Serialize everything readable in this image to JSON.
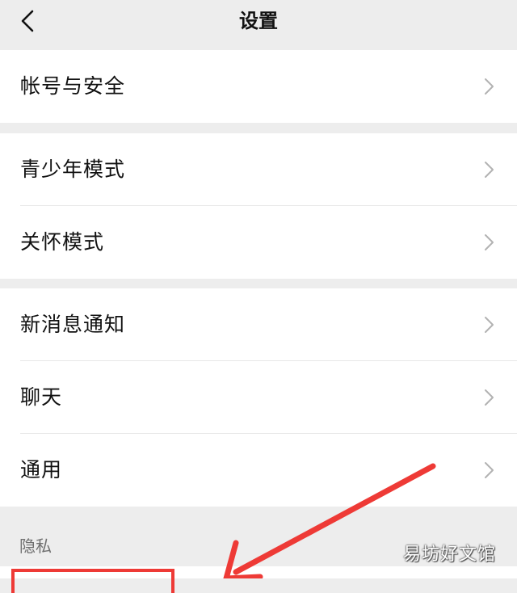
{
  "header": {
    "title": "设置",
    "back_icon": "chevron-left-icon"
  },
  "groups": [
    {
      "items": [
        {
          "label": "帐号与安全"
        }
      ]
    },
    {
      "items": [
        {
          "label": "青少年模式"
        },
        {
          "label": "关怀模式"
        }
      ]
    },
    {
      "items": [
        {
          "label": "新消息通知"
        },
        {
          "label": "聊天"
        },
        {
          "label": "通用"
        }
      ]
    }
  ],
  "section_privacy": {
    "label": "隐私"
  },
  "annotation": {
    "color": "#ee3a36"
  },
  "watermark": "易坊好文馆"
}
